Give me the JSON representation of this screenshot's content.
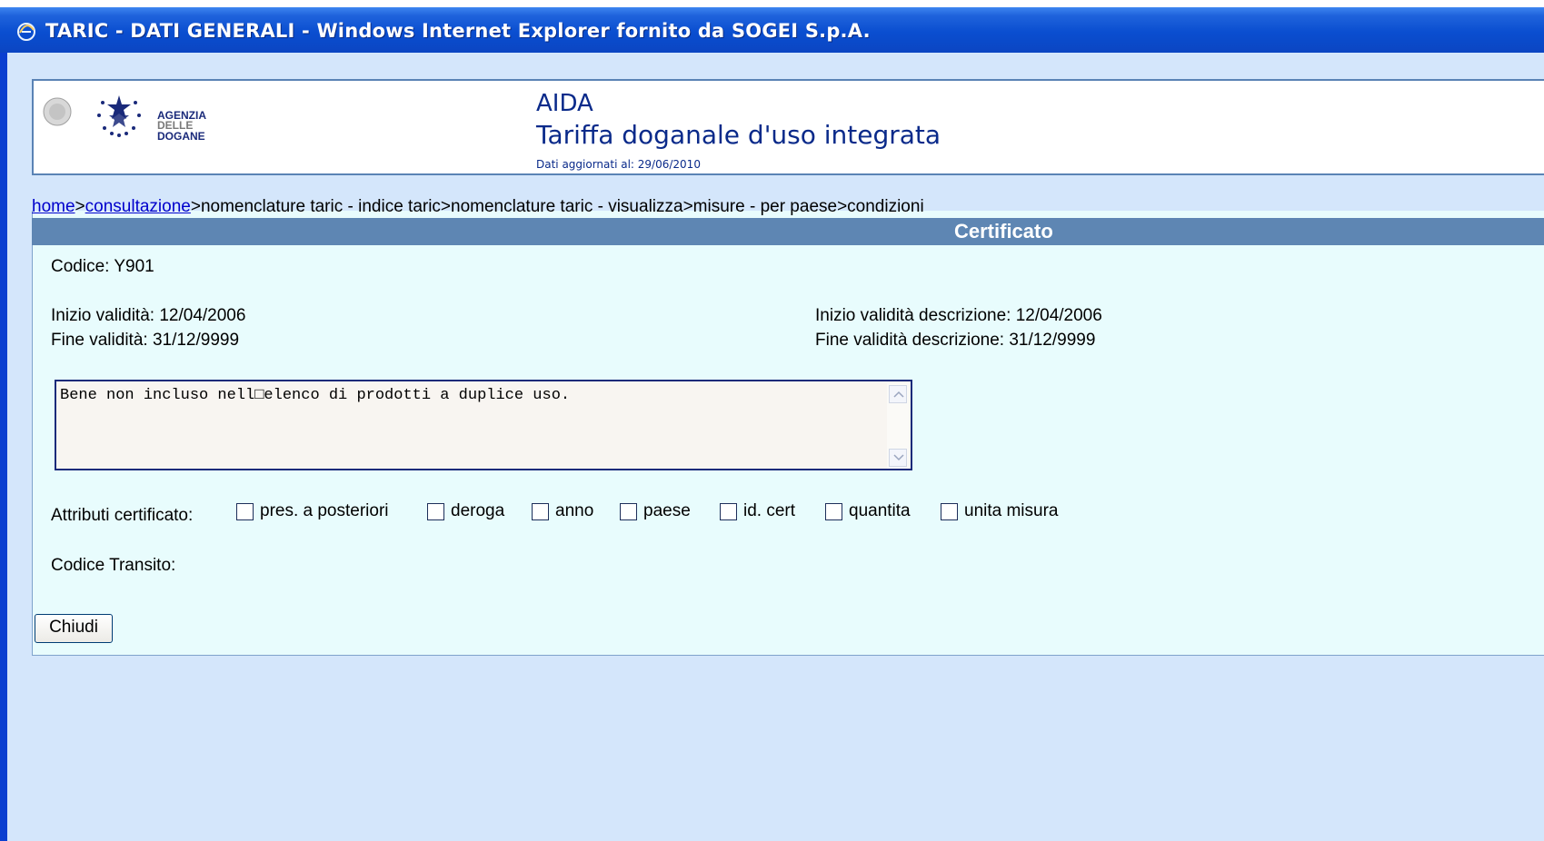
{
  "window": {
    "title": "TARIC - DATI GENERALI - Windows Internet Explorer fornito da SOGEI S.p.A."
  },
  "header": {
    "logo_text": "AGENZIA DELLE DOGANE",
    "app_name": "AIDA",
    "app_subtitle": "Tariffa doganale d'uso integrata",
    "updated": "Dati aggiornati al: 29/06/2010"
  },
  "breadcrumb": {
    "home": "home",
    "sep1": ">",
    "consultazione": "consultazione",
    "rest": ">nomenclature taric - indice taric>nomenclature taric - visualizza>misure - per paese>condizioni"
  },
  "section": {
    "title": "Certificato"
  },
  "details": {
    "codice": "Codice: Y901",
    "inizio_validita": "Inizio validità: 12/04/2006",
    "fine_validita": "Fine validità: 31/12/9999",
    "inizio_validita_descr": "Inizio validità descrizione: 12/04/2006",
    "fine_validita_descr": "Fine validità descrizione: 31/12/9999",
    "description": "Bene non incluso nell□elenco di prodotti a duplice uso.",
    "attributi_label": "Attributi certificato:",
    "codice_transito": "Codice Transito:"
  },
  "attributes": [
    {
      "label": "pres. a posteriori",
      "checked": false
    },
    {
      "label": "deroga",
      "checked": false
    },
    {
      "label": "anno",
      "checked": false
    },
    {
      "label": "paese",
      "checked": false
    },
    {
      "label": "id. cert",
      "checked": false
    },
    {
      "label": "quantita",
      "checked": false
    },
    {
      "label": "unita misura",
      "checked": false
    }
  ],
  "buttons": {
    "close": "Chiudi"
  }
}
